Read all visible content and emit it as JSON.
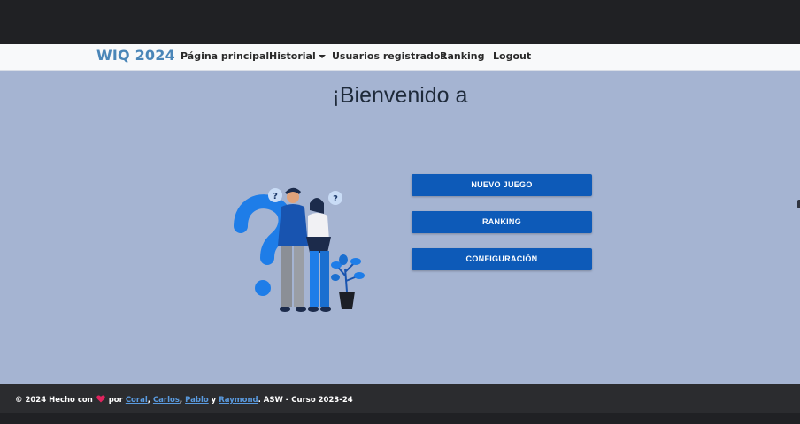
{
  "navbar": {
    "brand": "WIQ 2024",
    "links": [
      {
        "label": "Página principal"
      },
      {
        "label": "Historial",
        "dropdown": true
      },
      {
        "label": "Usuarios registrados"
      },
      {
        "label": "Ranking"
      },
      {
        "label": "Logout"
      }
    ]
  },
  "main": {
    "title": "¡Bienvenido a",
    "buttons": [
      {
        "label": "NUEVO JUEGO"
      },
      {
        "label": "RANKING"
      },
      {
        "label": "CONFIGURACIÓN"
      }
    ],
    "illustration_icon": "question-marks-people-illustration"
  },
  "footer": {
    "prefix": "© 2024 Hecho con",
    "heart_icon": "heart-icon",
    "by": "por",
    "authors": [
      "Coral",
      "Carlos",
      "Pablo",
      "Raymond"
    ],
    "sep_comma": ",",
    "sep_and": "y",
    "suffix": ". ASW - Curso 2023-24"
  },
  "colors": {
    "brand": "#4a86b8",
    "background": "#a5b4d2",
    "button": "#0d5ab8",
    "link": "#5a9be0"
  }
}
